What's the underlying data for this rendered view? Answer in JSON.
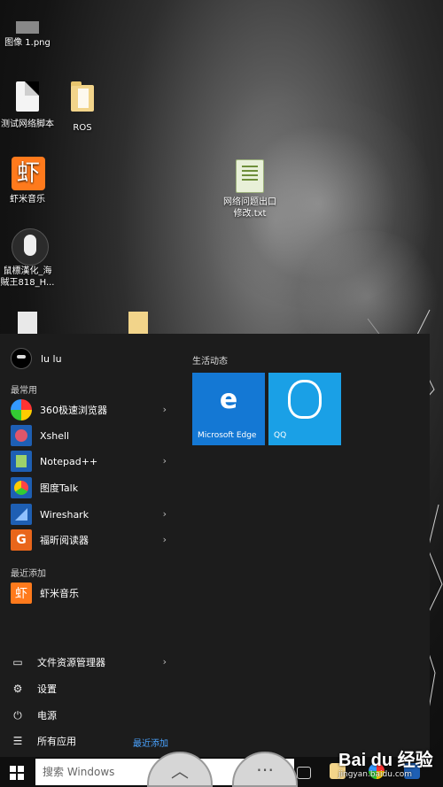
{
  "desktop": {
    "icons": [
      {
        "label": "图像 1.png"
      },
      {
        "label": "测试网络脚本"
      },
      {
        "label": "ROS"
      },
      {
        "label": "虾米音乐",
        "glyph": "虾"
      },
      {
        "label": "网络问题出口修改.txt"
      },
      {
        "label": "鼠標漢化_海賊王818_H..."
      }
    ]
  },
  "start_menu": {
    "user_name": "lu lu",
    "most_used_title": "最常用",
    "most_used": [
      {
        "label": "360极速浏览器",
        "icon": "browser-360-icon",
        "color": "#2a7de1",
        "has_submenu": true
      },
      {
        "label": "Xshell",
        "icon": "xshell-icon",
        "color": "#1e5fb3",
        "has_submenu": false
      },
      {
        "label": "Notepad++",
        "icon": "notepad-plus-icon",
        "color": "#1e5fb3",
        "has_submenu": true
      },
      {
        "label": "图度Talk",
        "icon": "tudotalk-icon",
        "color": "#1e5fb3",
        "has_submenu": false
      },
      {
        "label": "Wireshark",
        "icon": "wireshark-icon",
        "color": "#1e5fb3",
        "has_submenu": true
      },
      {
        "label": "福昕阅读器",
        "icon": "foxit-reader-icon",
        "color": "#e9661b",
        "has_submenu": true
      }
    ],
    "recently_added_title": "最近添加",
    "recently_added": [
      {
        "label": "虾米音乐",
        "glyph": "虾",
        "icon": "xiami-music-icon",
        "color": "#ff7a1c"
      }
    ],
    "system": [
      {
        "label": "文件资源管理器",
        "icon": "file-explorer-icon",
        "has_submenu": true
      },
      {
        "label": "设置",
        "icon": "settings-gear-icon"
      },
      {
        "label": "电源",
        "icon": "power-icon"
      },
      {
        "label": "所有应用",
        "icon": "all-apps-icon"
      }
    ],
    "recent_link": "最近添加",
    "tiles_title": "生活动态",
    "tiles": [
      {
        "label": "Microsoft Edge",
        "glyph": "e",
        "color": "#1478d4"
      },
      {
        "label": "QQ",
        "color": "#1aa0e6"
      }
    ]
  },
  "taskbar": {
    "search_placeholder": "搜索 Windows"
  },
  "watermark": {
    "main": "Bai du 经验",
    "sub": "jingyan.baidu.com"
  }
}
